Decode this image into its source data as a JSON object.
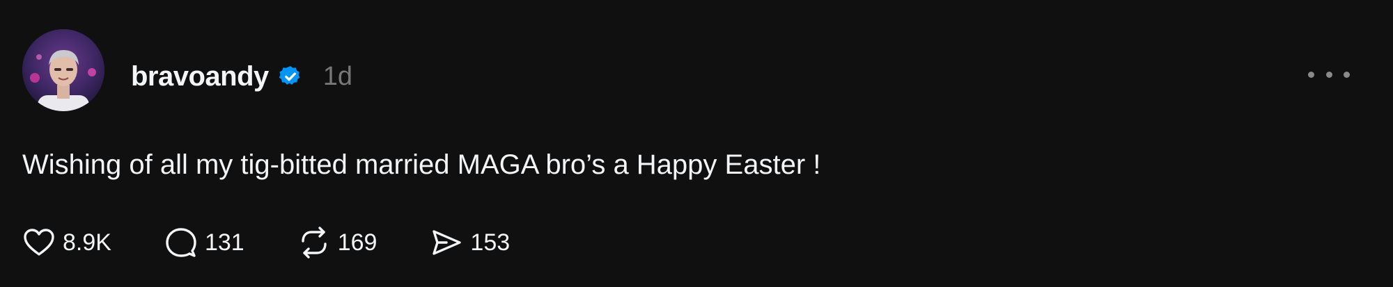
{
  "post": {
    "username": "bravoandy",
    "timestamp": "1d",
    "text": "Wishing of all my tig-bitted married MAGA bro’s a Happy Easter !",
    "avatar_icon": "profile-photo",
    "verified_icon": "verified-badge-icon",
    "more_icon": "more-options-icon"
  },
  "actions": {
    "like": {
      "icon": "heart-icon",
      "count": "8.9K"
    },
    "reply": {
      "icon": "comment-icon",
      "count": "131"
    },
    "repost": {
      "icon": "repost-icon",
      "count": "169"
    },
    "share": {
      "icon": "send-icon",
      "count": "153"
    }
  },
  "colors": {
    "background": "#101010",
    "text": "#f3f5f7",
    "muted": "#777777",
    "verified": "#0095f6"
  }
}
